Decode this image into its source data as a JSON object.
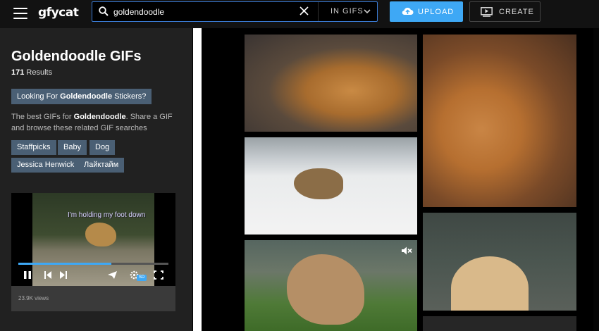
{
  "header": {
    "logo": "gfycat",
    "search": {
      "value": "goldendoodle",
      "scope": "IN GIFS"
    },
    "upload_label": "UPLOAD",
    "create_label": "CREATE"
  },
  "sidebar": {
    "title": "Goldendoodle GIFs",
    "result_count": "171",
    "result_suffix": "Results",
    "sticker_prefix": "Looking For ",
    "sticker_term": "Goldendoodle",
    "sticker_suffix": " Stickers?",
    "desc_prefix": "The best GIFs for ",
    "desc_term": "Goldendoodle",
    "desc_suffix": ". Share a GIF and browse these related GIF searches",
    "tags": [
      "Staffpicks",
      "Baby",
      "Dog",
      "Jessica Henwick",
      "Лайктайм"
    ],
    "video": {
      "caption": "I'm holding my foot down",
      "progress": 0.62,
      "hd_badge": "SD",
      "views": "23.9K views"
    }
  },
  "colors": {
    "accent": "#3ea8f5",
    "tag_bg": "#4a5f74",
    "sidebar_bg": "#212121"
  }
}
